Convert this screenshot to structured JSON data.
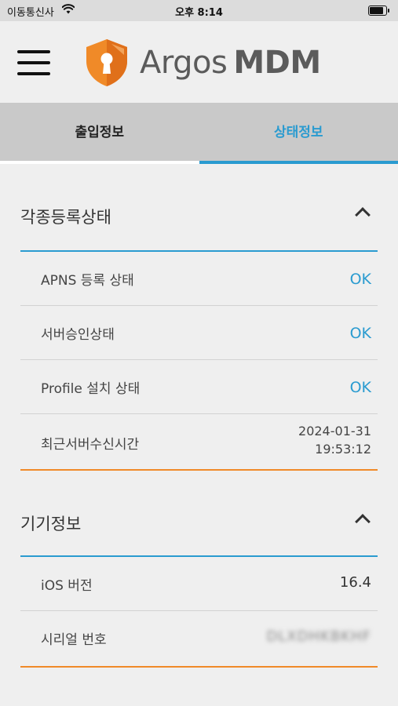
{
  "status_bar": {
    "carrier": "이동통신사",
    "time": "오후 8:14",
    "wifi_icon": "wifi-icon",
    "battery_icon": "battery-icon"
  },
  "header": {
    "menu_icon": "hamburger-menu-icon",
    "logo_icon": "shield-keyhole-icon",
    "brand_name": "Argos",
    "brand_suffix": "MDM",
    "brand_color": "#f08a28"
  },
  "tabs": [
    {
      "label": "출입정보",
      "active": false
    },
    {
      "label": "상태정보",
      "active": true
    }
  ],
  "accent_color": "#2a9bd0",
  "sections": [
    {
      "title": "각종등록상태",
      "expanded": true,
      "rows": [
        {
          "label": "APNS 등록 상태",
          "value": "OK"
        },
        {
          "label": "서버승인상태",
          "value": "OK"
        },
        {
          "label": "Profile 설치 상태",
          "value": "OK"
        },
        {
          "label": "최근서버수신시간",
          "value_line1": "2024-01-31",
          "value_line2": "19:53:12"
        }
      ]
    },
    {
      "title": "기기정보",
      "expanded": true,
      "rows": [
        {
          "label": "iOS 버전",
          "value": "16.4"
        },
        {
          "label": "시리얼 번호",
          "value": "DLXDHKBKHF"
        }
      ]
    }
  ]
}
